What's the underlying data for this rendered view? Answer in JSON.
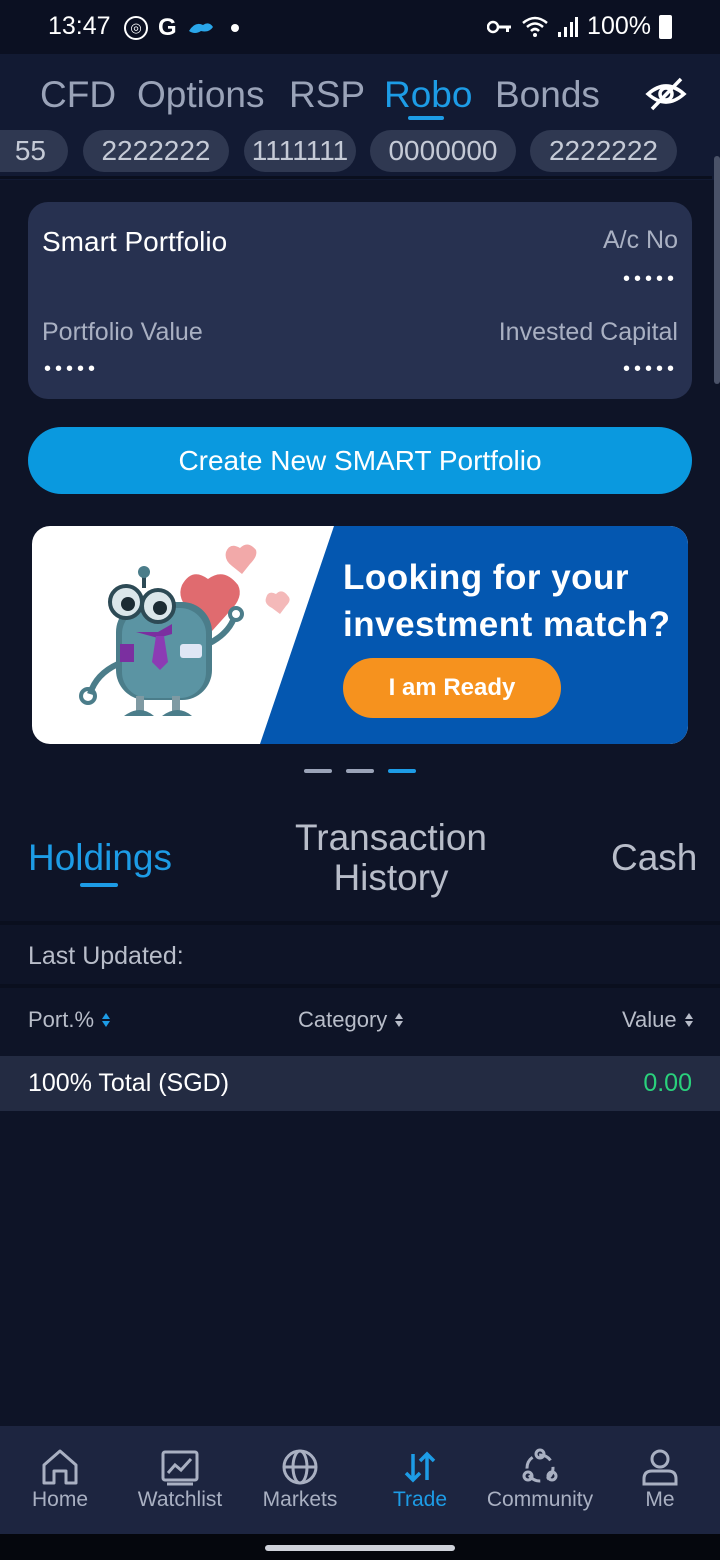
{
  "status_bar": {
    "time": "13:47",
    "battery": "100%"
  },
  "product_tabs": [
    "CFD",
    "Options",
    "RSP",
    "Robo",
    "Bonds"
  ],
  "product_tabs_active": "Robo",
  "accounts": [
    "55",
    "2222222",
    "1111111",
    "0000000",
    "2222222"
  ],
  "portfolio_card": {
    "title": "Smart Portfolio",
    "acno_label": "A/c No",
    "acno_value": "•••••",
    "portfolio_value_label": "Portfolio Value",
    "portfolio_value": "•••••",
    "invested_capital_label": "Invested Capital",
    "invested_capital": "•••••"
  },
  "create_button": "Create New SMART Portfolio",
  "banner": {
    "line1": "Looking for your",
    "line2": "investment match?",
    "cta": "I am Ready"
  },
  "section_tabs": {
    "holdings": "Holdings",
    "transaction_line1": "Transaction",
    "transaction_line2": "History",
    "cash": "Cash"
  },
  "last_updated": "Last Updated:",
  "columns": {
    "port": "Port.%",
    "category": "Category",
    "value": "Value"
  },
  "total_row": {
    "label": "100% Total (SGD)",
    "value": "0.00"
  },
  "bottom_nav": {
    "home": "Home",
    "watchlist": "Watchlist",
    "markets": "Markets",
    "trade": "Trade",
    "community": "Community",
    "me": "Me"
  },
  "colors": {
    "accent": "#1d9ce6",
    "background": "#0e1427",
    "card": "#273150",
    "positive": "#2ad17c",
    "cta_orange": "#f6921e"
  }
}
